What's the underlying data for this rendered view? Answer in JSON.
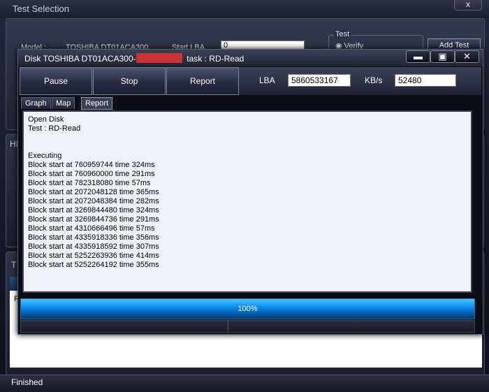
{
  "parent": {
    "title": "Test Selection",
    "close_label": "x",
    "model_label": "Model :",
    "model_value": "TOSHIBA DT01ACA300",
    "start_lba_label": "Start LBA",
    "start_lba_value": "0",
    "test_group_label": "Test",
    "verify_label": "Verify",
    "add_test_label": "Add Test",
    "hd_label": "HD",
    "t_label": "T",
    "r_label": "R",
    "status_text": "Finished"
  },
  "dialog": {
    "title_prefix": "Disk TOSHIBA DT01ACA300-",
    "title_suffix": "task : RD-Read",
    "controls": {
      "minimize": "▬",
      "maximize": "▣",
      "close": "✕"
    },
    "toolbar": {
      "pause": "Pause",
      "stop": "Stop",
      "report": "Report"
    },
    "lba_label": "LBA",
    "lba_value": "5860533167",
    "kbs_label": "KB/s",
    "kbs_value": "52480",
    "tabs": [
      "Graph",
      "Map",
      "Report"
    ],
    "active_tab": "Report",
    "report_lines": [
      "Open Disk",
      "Test : RD-Read",
      "",
      "",
      "Executing",
      "Block start at 760959744 time 324ms",
      "Block start at 760960000 time 291ms",
      "Block start at 782318080 time 57ms",
      "Block start at 2072048128 time 365ms",
      "Block start at 2072048384 time 282ms",
      "Block start at 3269844480 time 324ms",
      "Block start at 3269844736 time 291ms",
      "Block start at 4310666496 time 57ms",
      "Block start at 4335918336 time 356ms",
      "Block start at 4335918592 time 307ms",
      "Block start at 5252263936 time 414ms",
      "Block start at 5252264192 time 355ms"
    ],
    "progress": {
      "percent": 100,
      "label": "100%"
    }
  },
  "colors": {
    "accent": "#1b7fd0",
    "redaction": "#c83232"
  }
}
